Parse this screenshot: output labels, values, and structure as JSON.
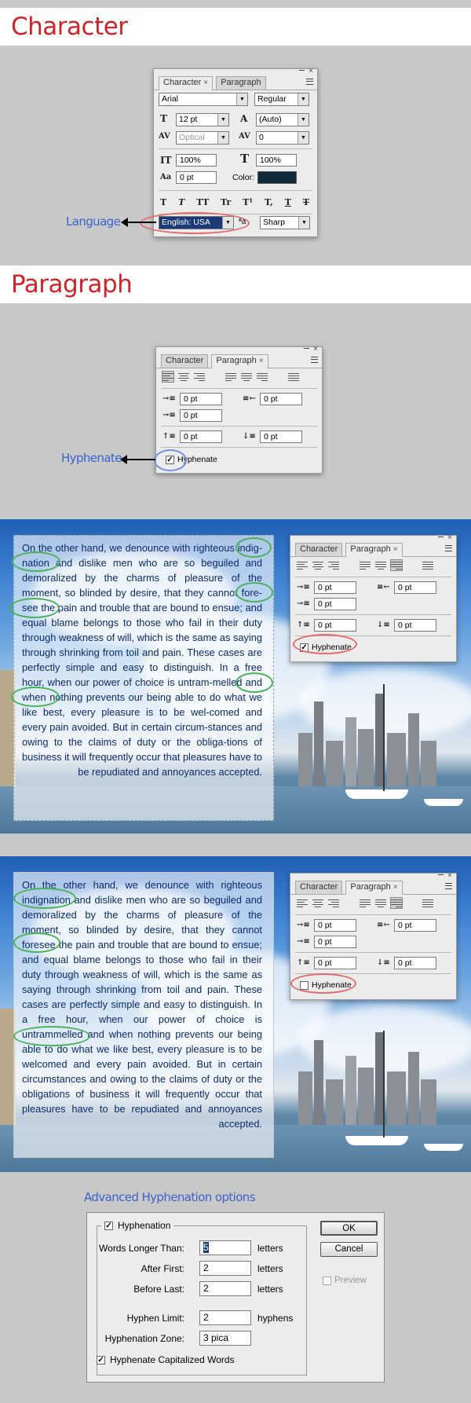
{
  "sections": {
    "character_title": "Character",
    "paragraph_title": "Paragraph"
  },
  "character_panel": {
    "tabs": [
      "Character",
      "Paragraph"
    ],
    "font_family": "Arial",
    "font_style": "Regular",
    "font_size": "12 pt",
    "leading": "(Auto)",
    "kerning": "Optical",
    "tracking": "0",
    "vertical_scale": "100%",
    "horizontal_scale": "100%",
    "baseline_shift": "0 pt",
    "color_label": "Color:",
    "color_value": "#0f2a3a",
    "type_buttons": [
      "T",
      "T",
      "TT",
      "Tr",
      "T¹",
      "T,",
      "T",
      "T"
    ],
    "language": "English: USA",
    "aa_label": "ªa",
    "antialias": "Sharp"
  },
  "annotations": {
    "language": "Language",
    "hyphenate": "Hyphenate",
    "advanced": "Advanced Hyphenation options"
  },
  "paragraph_panel": {
    "tabs": [
      "Character",
      "Paragraph"
    ],
    "indent_left": "0 pt",
    "indent_right": "0 pt",
    "indent_first": "0 pt",
    "space_before": "0 pt",
    "space_after": "0 pt",
    "hyphenate_label": "Hyphenate",
    "hyphenate_checked": "✓"
  },
  "example1": {
    "text": "On the other hand, we denounce with righteous indig-nation and dislike men who are so beguiled and demoralized by the charms of pleasure of the moment, so blinded by desire, that they cannot fore-see the pain and trouble that are bound to ensue; and equal blame belongs to those who fail in their duty through weakness of will, which is the same as saying through shrinking from toil and pain. These cases are perfectly simple and easy to distinguish. In a free hour, when our power of choice is untram-melled and when nothing prevents our being able to do what we like best, every pleasure is to be wel-comed and every pain avoided. But in certain circum-stances and owing to the claims of duty or the obliga-tions of business it will frequently occur that pleasures have to be repudiated and annoyances accepted.",
    "hyphenate_checked": "✓"
  },
  "example2": {
    "text": "On the other hand, we denounce with righteous indignation and dislike men who are so beguiled and demoralized by the charms of pleasure of the moment, so blinded by desire, that they cannot foresee the pain and trouble that are bound to ensue; and equal blame belongs to those who fail in their duty through weakness of will, which is the same as saying through shrinking from toil and pain. These cases are perfectly simple and easy to distinguish. In a free hour, when our power of choice is untrammelled and when nothing prevents our being able to do what we like best, every pleasure is to be welcomed and every pain avoided. But in certain circumstances and owing to the claims of duty or the obligations of business it will frequently occur that pleasures have to be repudiated and annoyances accepted.",
    "hyphenate_checked": ""
  },
  "dialog": {
    "group_label": "Hyphenation",
    "group_checked": "✓",
    "words_longer_label": "Words Longer Than:",
    "words_longer_value": "5",
    "after_first_label": "After First:",
    "after_first_value": "2",
    "before_last_label": "Before Last:",
    "before_last_value": "2",
    "letters": "letters",
    "hyphen_limit_label": "Hyphen Limit:",
    "hyphen_limit_value": "2",
    "hyphens": "hyphens",
    "zone_label": "Hyphenation Zone:",
    "zone_value": "3 pica",
    "cap_label": "Hyphenate Capitalized Words",
    "cap_checked": "✓",
    "ok": "OK",
    "cancel": "Cancel",
    "preview": "Preview"
  }
}
